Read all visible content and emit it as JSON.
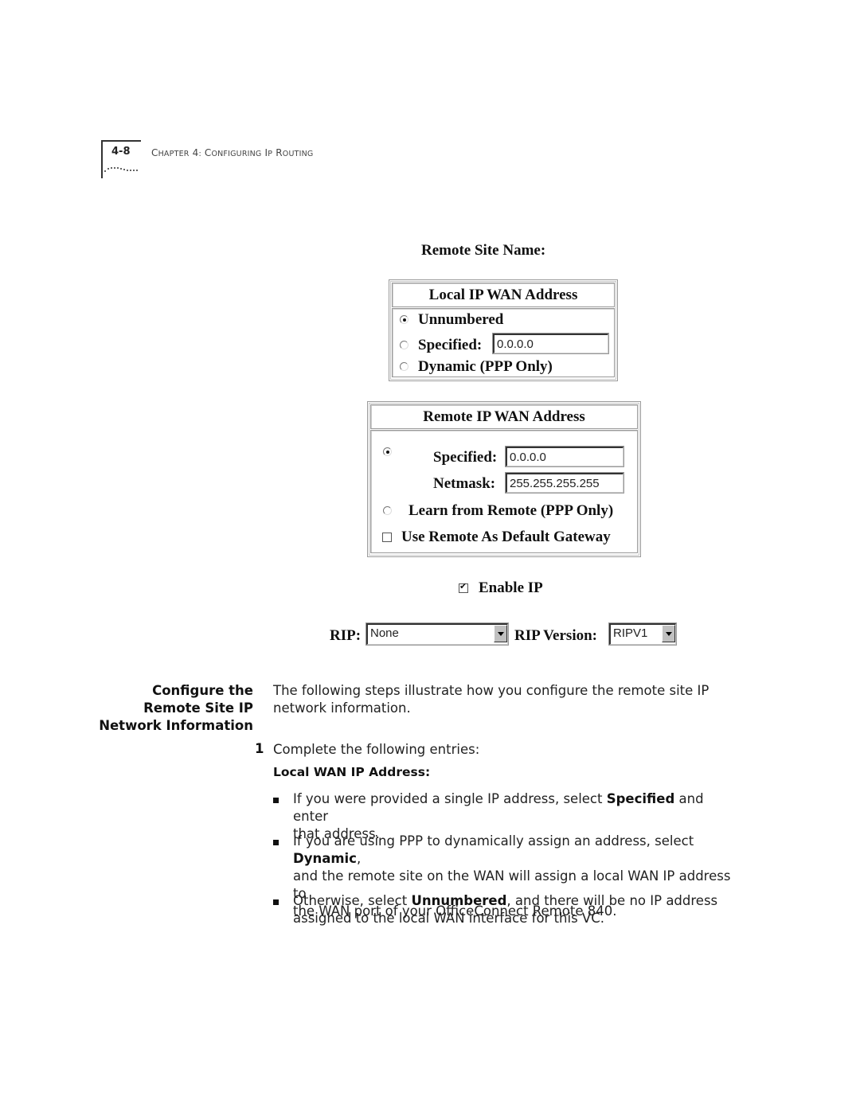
{
  "header": {
    "page_number": "4-8",
    "chapter": "Chapter 4: Configuring IP Routing"
  },
  "form": {
    "remote_site_name_label": "Remote Site Name:",
    "local_wan": {
      "title": "Local IP WAN Address",
      "options": {
        "unnumbered": {
          "label": "Unnumbered",
          "selected": true
        },
        "specified": {
          "label": "Specified:",
          "selected": false,
          "value": "0.0.0.0"
        },
        "dynamic": {
          "label": "Dynamic (PPP Only)",
          "selected": false
        }
      }
    },
    "remote_wan": {
      "title": "Remote IP WAN Address",
      "specified": {
        "label": "Specified:",
        "selected": true,
        "value": "0.0.0.0"
      },
      "netmask": {
        "label": "Netmask:",
        "value": "255.255.255.255"
      },
      "learn": {
        "label": "Learn from Remote (PPP Only)",
        "selected": false
      },
      "default_gateway": {
        "label": "Use Remote As Default Gateway",
        "checked": false
      }
    },
    "enable_ip": {
      "label": "Enable IP",
      "checked": true
    },
    "rip": {
      "label": "RIP:",
      "value": "None"
    },
    "rip_version": {
      "label": "RIP Version:",
      "value": "RIPV1"
    }
  },
  "section": {
    "heading_lines": [
      "Configure the",
      "Remote Site IP",
      "Network Information"
    ],
    "intro_lines": [
      "The following steps illustrate how you configure the remote site IP",
      "network information."
    ],
    "step_number": "1",
    "step_text": "Complete the following entries:",
    "subheading": "Local WAN IP Address:",
    "bullets": [
      {
        "pre": "If you were provided a single IP address, select ",
        "bold": "Specified",
        "post": " and enter",
        "line2": "that address."
      },
      {
        "pre": "If you are using PPP to dynamically assign an address, select ",
        "bold": "Dynamic",
        "post": ",",
        "line2": "and the remote site on the WAN will assign a local WAN IP address to",
        "line3": "the WAN port of your OfficeConnect Remote 840."
      },
      {
        "pre": "Otherwise, select ",
        "bold": "Unnumbered",
        "post": ", and there will be no IP address",
        "line2": "assigned to the local WAN interface for this VC."
      }
    ]
  }
}
